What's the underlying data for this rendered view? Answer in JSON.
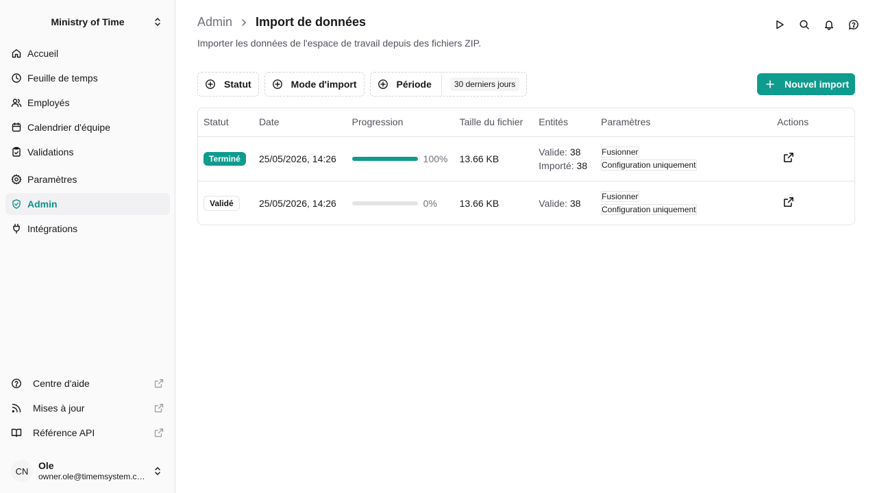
{
  "sidebar": {
    "workspace": "Ministry of Time",
    "items": [
      {
        "label": "Accueil",
        "icon": "home-icon"
      },
      {
        "label": "Feuille de temps",
        "icon": "clock-icon"
      },
      {
        "label": "Employés",
        "icon": "users-icon"
      },
      {
        "label": "Calendrier d'équipe",
        "icon": "calendar-icon"
      },
      {
        "label": "Validations",
        "icon": "clipboard-check-icon"
      },
      {
        "label": "Paramètres",
        "icon": "gear-icon"
      },
      {
        "label": "Admin",
        "icon": "shield-icon",
        "active": true
      },
      {
        "label": "Intégrations",
        "icon": "plug-icon"
      }
    ],
    "footer": [
      {
        "label": "Centre d'aide",
        "icon": "help-circle-icon"
      },
      {
        "label": "Mises à jour",
        "icon": "rss-icon"
      },
      {
        "label": "Référence API",
        "icon": "book-icon"
      }
    ],
    "user": {
      "initials": "CN",
      "name": "Ole",
      "email": "owner.ole@timemsystem.com"
    }
  },
  "header": {
    "crumb": "Admin",
    "title": "Import de données",
    "subtitle": "Importer les données de l'espace de travail depuis des fichiers ZIP."
  },
  "filters": {
    "status": "Statut",
    "mode": "Mode d'import",
    "period": "Période",
    "period_value": "30 derniers jours"
  },
  "new_import": "Nouvel import",
  "table": {
    "headers": [
      "Statut",
      "Date",
      "Progression",
      "Taille du fichier",
      "Entités",
      "Paramètres",
      "Actions"
    ],
    "rows": [
      {
        "status": "Terminé",
        "date": "25/05/2026, 14:26",
        "progress": 100,
        "progress_label": "100%",
        "size": "13.66 KB",
        "valid_label": "Valide:",
        "valid": "38",
        "imported_label": "Importé:",
        "imported": "38",
        "tags": [
          "Fusionner",
          "Configuration uniquement"
        ]
      },
      {
        "status": "Validé",
        "date": "25/05/2026, 14:26",
        "progress": 0,
        "progress_label": "0%",
        "size": "13.66 KB",
        "valid_label": "Valide:",
        "valid": "38",
        "imported_label": "",
        "imported": "",
        "tags": [
          "Fusionner",
          "Configuration uniquement"
        ]
      }
    ]
  },
  "colors": {
    "accent": "#0f9b8e"
  }
}
